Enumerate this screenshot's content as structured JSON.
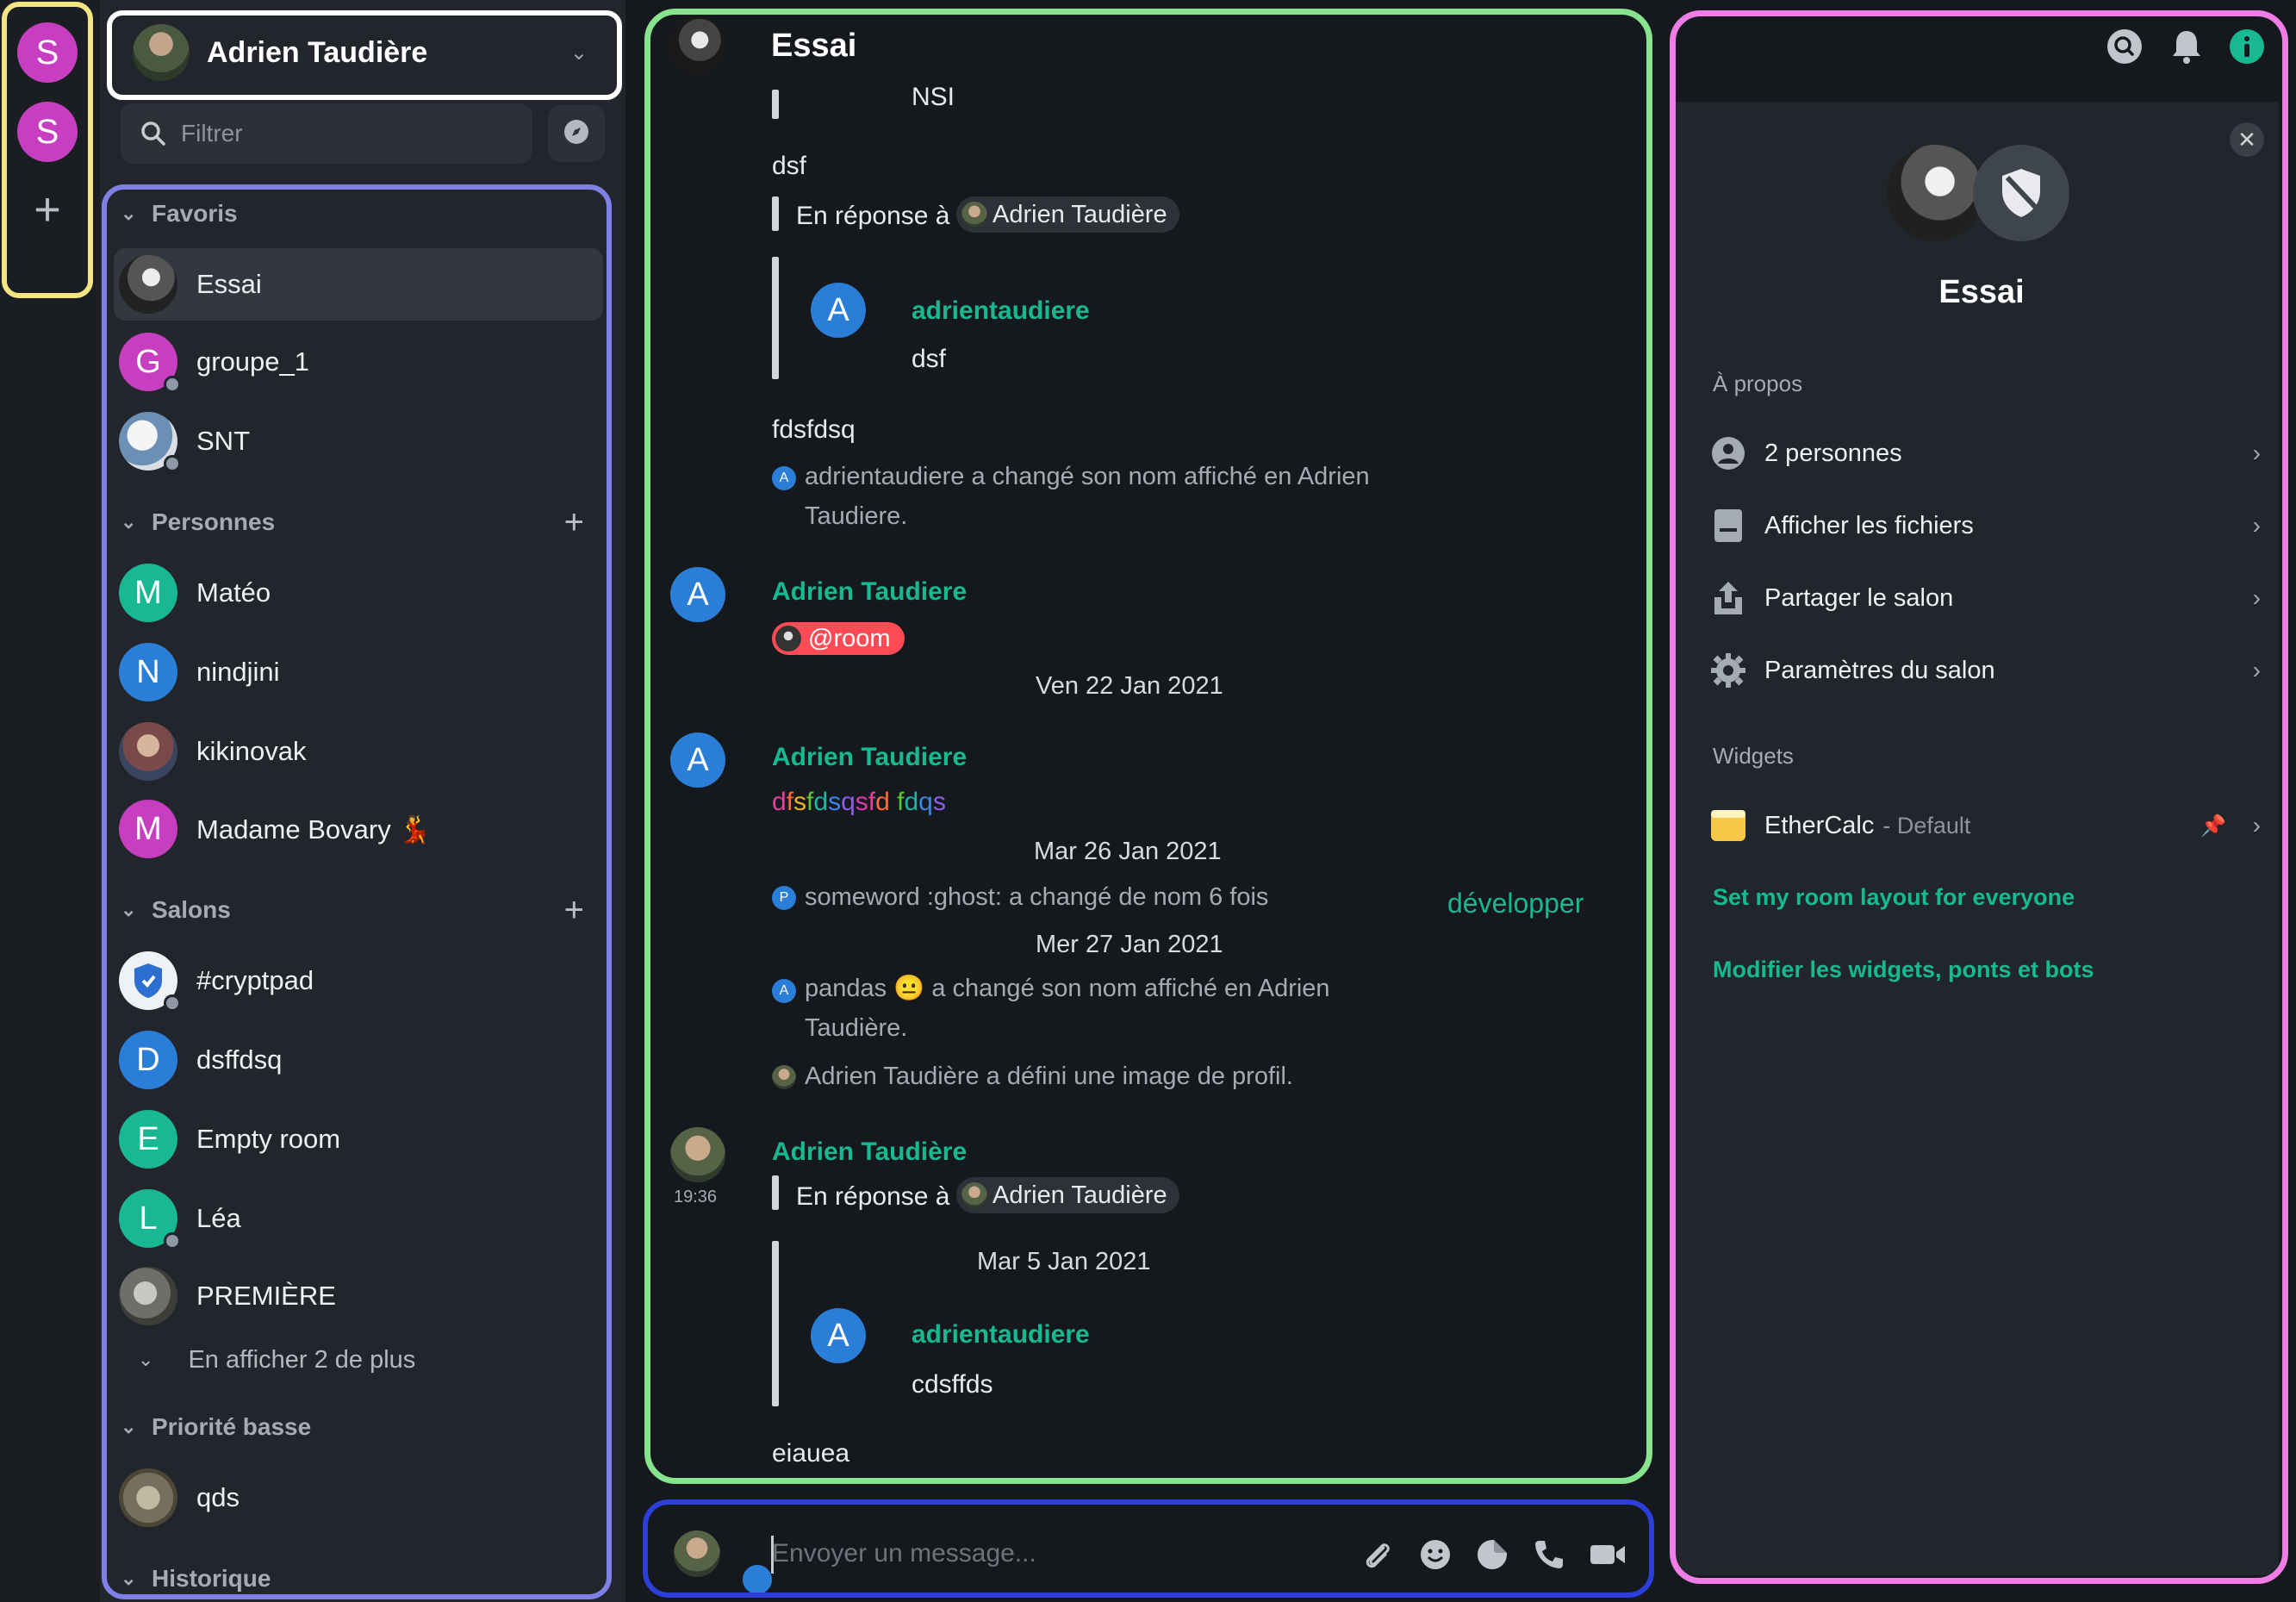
{
  "spaces": {
    "items": [
      {
        "letter": "S"
      },
      {
        "letter": "S"
      }
    ],
    "add_label": "+"
  },
  "account": {
    "name": "Adrien Taudière"
  },
  "filter": {
    "placeholder": "Filtrer"
  },
  "sections": {
    "favoris": "Favoris",
    "personnes": "Personnes",
    "salons": "Salons",
    "priorite": "Priorité basse",
    "historique": "Historique"
  },
  "rooms": {
    "favoris": [
      {
        "name": "Essai"
      },
      {
        "name": "groupe_1",
        "letter": "G"
      },
      {
        "name": "SNT"
      }
    ],
    "personnes": [
      {
        "name": "Matéo",
        "letter": "M"
      },
      {
        "name": "nindjini",
        "letter": "N"
      },
      {
        "name": "kikinovak"
      },
      {
        "name": "Madame Bovary 💃",
        "letter": "M"
      }
    ],
    "salons": [
      {
        "name": "#cryptpad"
      },
      {
        "name": "dsffdsq",
        "letter": "D"
      },
      {
        "name": "Empty room",
        "letter": "E"
      },
      {
        "name": "Léa",
        "letter": "L"
      },
      {
        "name": "PREMIÈRE"
      }
    ],
    "show_more": "En afficher 2 de plus",
    "priorite": [
      {
        "name": "qds"
      }
    ]
  },
  "timeline": {
    "room_title": "Essai",
    "partial_text": "NSI",
    "msg_dsf": "dsf",
    "reply1": {
      "prefix": "En réponse à",
      "user": "Adrien Taudière"
    },
    "quote1": {
      "avatar": "A",
      "sender": "adrientaudiere",
      "body": "dsf"
    },
    "msg_fdsfdsq": "fdsfdsq",
    "event1": "adrientaudiere a changé son nom affiché en Adrien Taudiere.",
    "event1_avatar": "A",
    "msg2": {
      "avatar": "A",
      "sender": "Adrien Taudiere",
      "pill": "@room"
    },
    "date1": "Ven 22 Jan 2021",
    "msg3": {
      "avatar": "A",
      "sender": "Adrien Taudiere",
      "rainbow": "dfsfdsqsfd fdqs"
    },
    "date2": "Mar 26 Jan 2021",
    "event2": "someword :ghost: a changé de nom 6 fois",
    "event2_avatar": "P",
    "expand": "développer",
    "date3": "Mer 27 Jan 2021",
    "event3": "pandas 😐 a changé son nom affiché en Adrien Taudière.",
    "event3_avatar": "A",
    "event4": "Adrien Taudière a défini une image de profil.",
    "msg4": {
      "sender": "Adrien Taudière",
      "time": "19:36"
    },
    "reply2": {
      "prefix": "En réponse à",
      "user": "Adrien Taudière"
    },
    "quote2": {
      "date": "Mar 5 Jan 2021",
      "avatar": "A",
      "sender": "adrientaudiere",
      "body": "cdsffds"
    },
    "msg_eiauea": "eiauea"
  },
  "composer": {
    "placeholder": "Envoyer un message..."
  },
  "right_panel": {
    "room_name": "Essai",
    "about_label": "À propos",
    "items": [
      {
        "label": "2 personnes",
        "icon": "person-icon"
      },
      {
        "label": "Afficher les fichiers",
        "icon": "file-icon"
      },
      {
        "label": "Partager le salon",
        "icon": "share-icon"
      },
      {
        "label": "Paramètres du salon",
        "icon": "gear-icon"
      }
    ],
    "widgets_label": "Widgets",
    "widget": {
      "name": "EtherCalc",
      "suffix": "- Default"
    },
    "link1": "Set my room layout for everyone",
    "link2": "Modifier les widgets, ponts et bots"
  },
  "colors": {
    "accent": "#17b892",
    "space_pink": "#c83ec0",
    "mention": "#ff4b55"
  }
}
